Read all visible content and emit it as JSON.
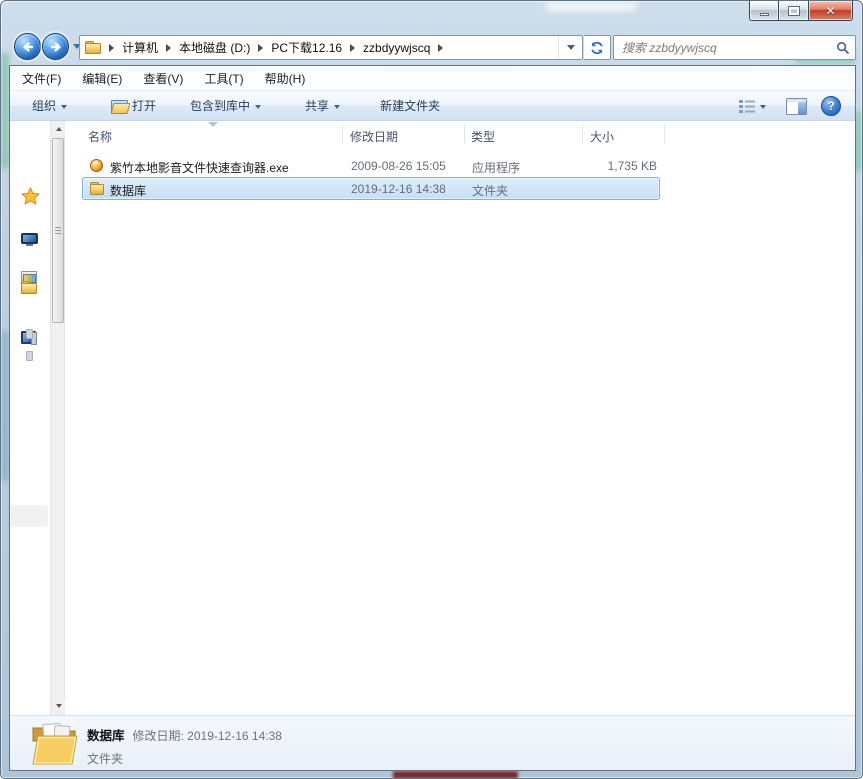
{
  "window": {
    "controls": {
      "close_glyph": "✕"
    }
  },
  "navigation": {
    "breadcrumb": [
      "计算机",
      "本地磁盘 (D:)",
      "PC下载12.16",
      "zzbdyywjscq"
    ],
    "search_placeholder": "搜索 zzbdyywjscq"
  },
  "menu": {
    "file": "文件(F)",
    "edit": "编辑(E)",
    "view": "查看(V)",
    "tools": "工具(T)",
    "help": "帮助(H)"
  },
  "toolbar": {
    "organize": "组织",
    "open": "打开",
    "include_in_library": "包含到库中",
    "share": "共享",
    "new_folder": "新建文件夹",
    "help_glyph": "?"
  },
  "file_list": {
    "columns": {
      "name": "名称",
      "date": "修改日期",
      "type": "类型",
      "size": "大小"
    },
    "sort_column": "名称",
    "rows": [
      {
        "name": "紫竹本地影音文件快速查询器.exe",
        "date": "2009-08-26 15:05",
        "type": "应用程序",
        "size": "1,735 KB",
        "icon": "application-icon",
        "selected": false
      },
      {
        "name": "数据库",
        "date": "2019-12-16 14:38",
        "type": "文件夹",
        "size": "",
        "icon": "folder-icon",
        "selected": true
      }
    ]
  },
  "details_pane": {
    "name": "数据库",
    "modified": "修改日期: 2019-12-16 14:38",
    "type": "文件夹"
  },
  "icons": {
    "nav": [
      "back-icon",
      "forward-icon",
      "refresh-icon",
      "search-icon",
      "address-folder-icon"
    ],
    "toolbar": [
      "open-folder-icon",
      "views-icon",
      "preview-pane-icon",
      "help-icon"
    ],
    "sidebar": [
      "favorites-star-icon",
      "desktop-icon",
      "libraries-icon",
      "documents-folder-icon",
      "computer-icon"
    ]
  },
  "colors": {
    "selection_bg": "#cde3fa",
    "selection_border": "#84acdd",
    "accent_blue": "#1c62b8",
    "glass_frame": "#bed1e2",
    "muted_text": "#666d76"
  }
}
